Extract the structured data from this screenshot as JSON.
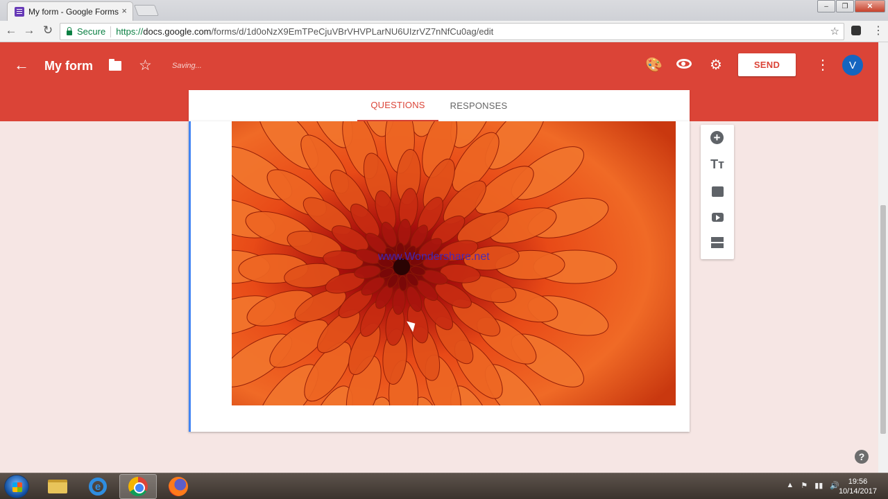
{
  "browser": {
    "tab_title": "My form - Google Forms",
    "tab_close_glyph": "×",
    "window_buttons": [
      "‒",
      "❐",
      "✕"
    ],
    "nav": {
      "back": "←",
      "forward": "→",
      "reload": "↻"
    },
    "secure_label": "Secure",
    "url_scheme": "https://",
    "url_domain": "docs.google.com",
    "url_path": "/forms/d/1d0oNzX9EmTPeCjuVBrVHVPLarNU6UIzrVZ7nNfCu0ag/edit",
    "bookmark_star": "☆",
    "menu": "⋮"
  },
  "header": {
    "back_glyph": "←",
    "title": "My form",
    "star_glyph": "☆",
    "status": "Saving...",
    "palette_glyph": "🎨",
    "gear_glyph": "⚙",
    "send_label": "SEND",
    "more_glyph": "⋮",
    "avatar_letter": "V",
    "colors": {
      "header": "#db4437",
      "avatar": "#1565c0",
      "accent": "#4285f4"
    }
  },
  "form_tabs": [
    {
      "label": "QUESTIONS",
      "active": true
    },
    {
      "label": "RESPONSES",
      "active": false
    }
  ],
  "form_image": {
    "description_icon": "image-content",
    "watermark": "www.Wondershare.net"
  },
  "tools": {
    "add_glyph": "+",
    "text_glyph": "Tт",
    "icons": [
      "add-question-icon",
      "add-title-icon",
      "add-image-icon",
      "add-video-icon",
      "add-section-icon"
    ]
  },
  "help_glyph": "?",
  "taskbar": {
    "items": [
      "windows-explorer",
      "internet-explorer",
      "google-chrome",
      "firefox"
    ],
    "tray_glyphs": [
      "▲",
      "⚑",
      "▮▮",
      "🔊"
    ],
    "time": "19:56",
    "date": "10/14/2017"
  }
}
